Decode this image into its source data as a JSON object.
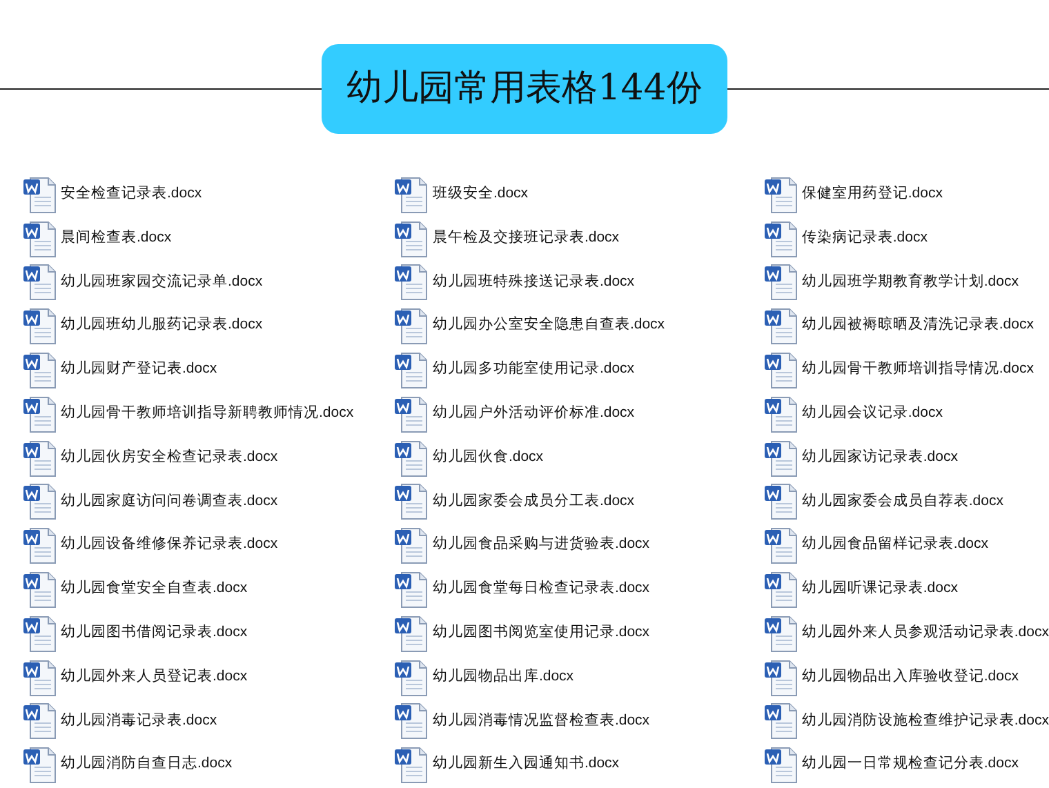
{
  "title": "幼儿园常用表格144份",
  "columns": [
    {
      "files": [
        "安全检查记录表.docx",
        "晨间检查表.docx",
        "幼儿园班家园交流记录单.docx",
        "幼儿园班幼儿服药记录表.docx",
        "幼儿园财产登记表.docx",
        "幼儿园骨干教师培训指导新聘教师情况.docx",
        "幼儿园伙房安全检查记录表.docx",
        "幼儿园家庭访问问卷调查表.docx",
        "幼儿园设备维修保养记录表.docx",
        "幼儿园食堂安全自查表.docx",
        "幼儿园图书借阅记录表.docx",
        "幼儿园外来人员登记表.docx",
        "幼儿园消毒记录表.docx",
        "幼儿园消防自查日志.docx"
      ]
    },
    {
      "files": [
        "班级安全.docx",
        "晨午检及交接班记录表.docx",
        "幼儿园班特殊接送记录表.docx",
        "幼儿园办公室安全隐患自查表.docx",
        "幼儿园多功能室使用记录.docx",
        "幼儿园户外活动评价标准.docx",
        "幼儿园伙食.docx",
        "幼儿园家委会成员分工表.docx",
        "幼儿园食品采购与进货验表.docx",
        "幼儿园食堂每日检查记录表.docx",
        "幼儿园图书阅览室使用记录.docx",
        "幼儿园物品出库.docx",
        "幼儿园消毒情况监督检查表.docx",
        "幼儿园新生入园通知书.docx"
      ]
    },
    {
      "files": [
        "保健室用药登记.docx",
        "传染病记录表.docx",
        "幼儿园班学期教育教学计划.docx",
        "幼儿园被褥晾晒及清洗记录表.docx",
        "幼儿园骨干教师培训指导情况.docx",
        "幼儿园会议记录.docx",
        "幼儿园家访记录表.docx",
        "幼儿园家委会成员自荐表.docx",
        "幼儿园食品留样记录表.docx",
        "幼儿园听课记录表.docx",
        "幼儿园外来人员参观活动记录表.docx",
        "幼儿园物品出入库验收登记.docx",
        "幼儿园消防设施检查维护记录表.docx",
        "幼儿园一日常规检查记分表.docx"
      ]
    }
  ]
}
